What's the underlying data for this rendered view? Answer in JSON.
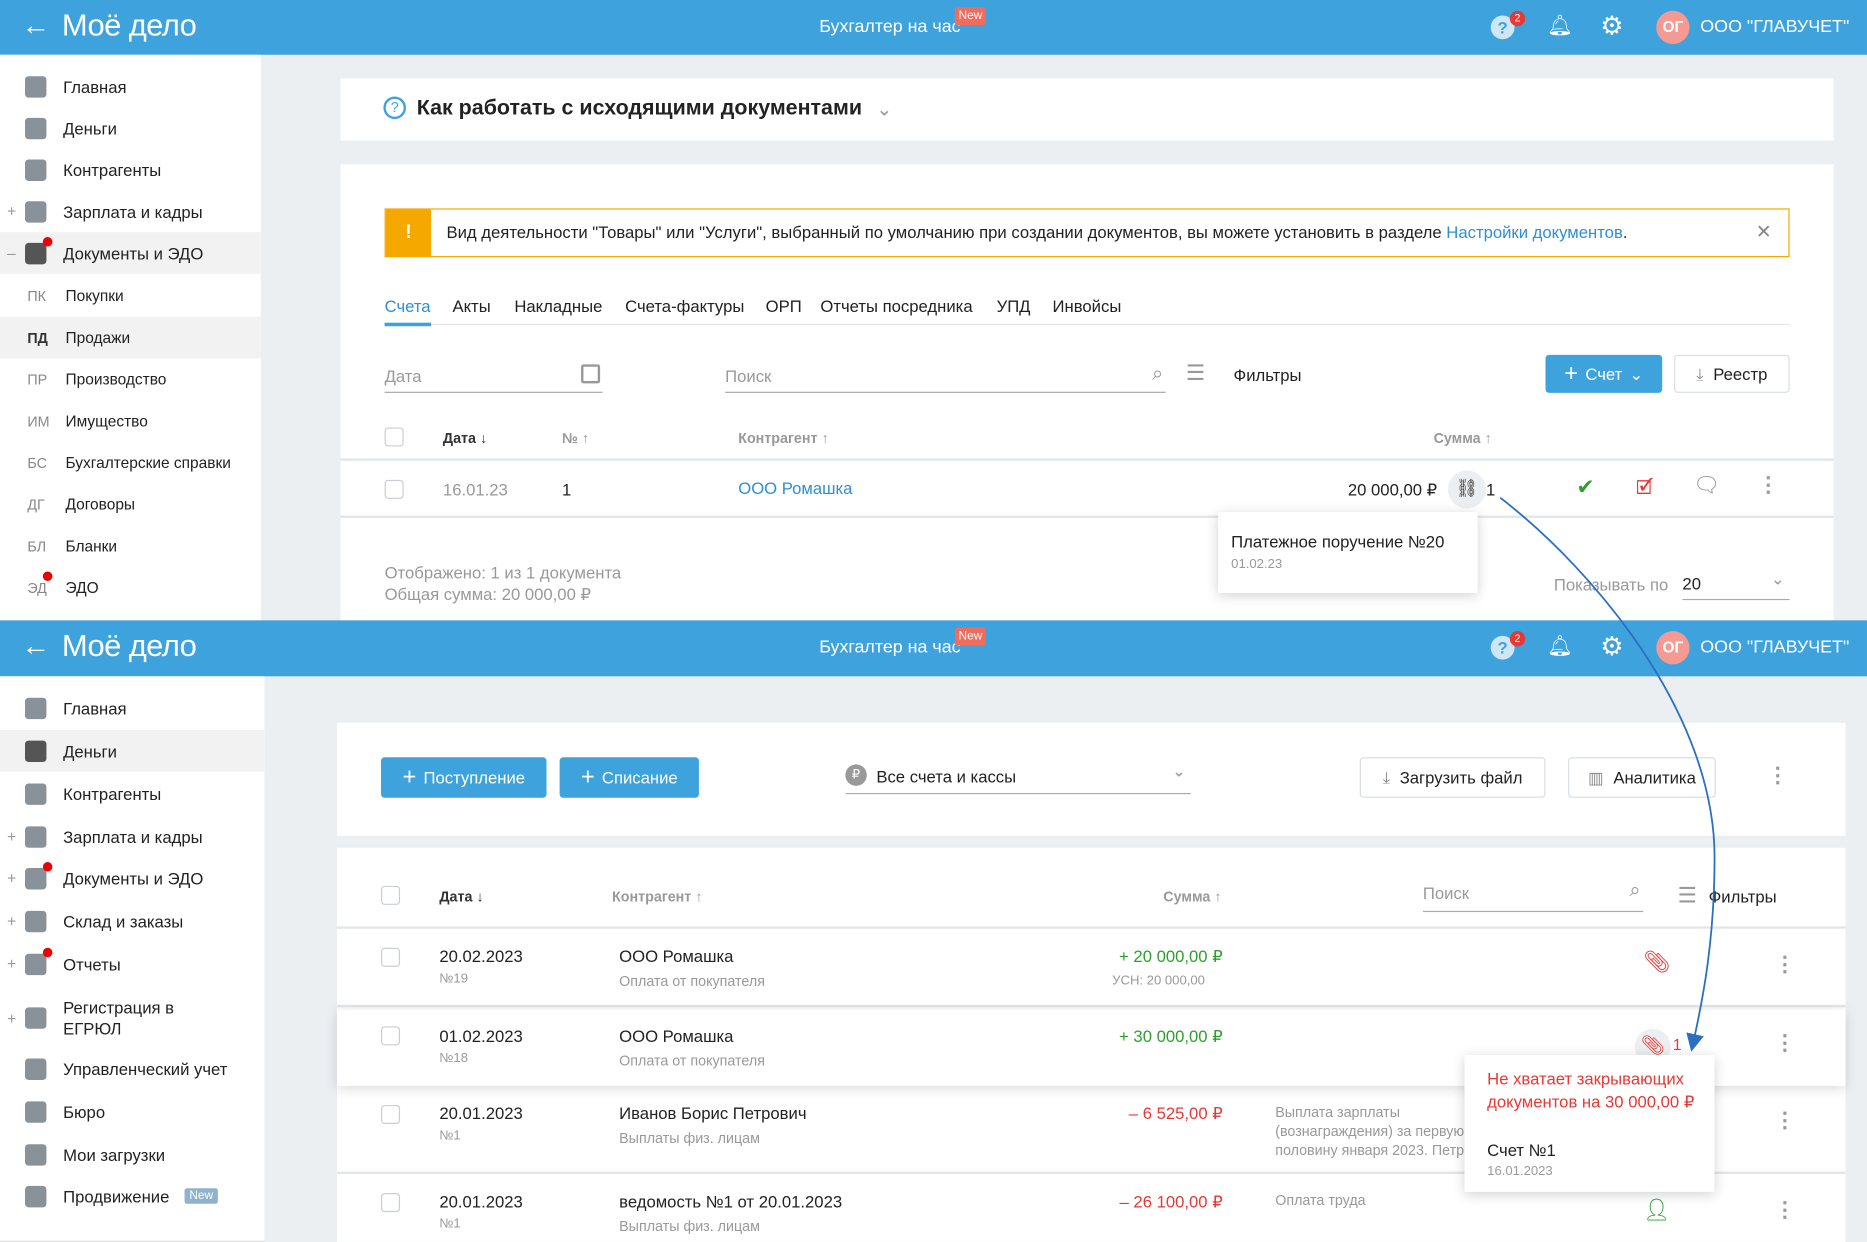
{
  "header": {
    "logo": "Моё дело",
    "center_link": "Бухгалтер на час",
    "new_badge": "New",
    "help_badge": "2",
    "avatar_initials": "ОГ",
    "org_name": "ООО \"ГЛАВУЧЕТ\""
  },
  "top": {
    "sidebar": [
      {
        "label": "Главная"
      },
      {
        "label": "Деньги"
      },
      {
        "label": "Контрагенты"
      },
      {
        "label": "Зарплата и кадры"
      },
      {
        "label": "Документы и ЭДО"
      }
    ],
    "subitems": [
      {
        "abbr": "ПК",
        "label": "Покупки"
      },
      {
        "abbr": "ПД",
        "label": "Продажи"
      },
      {
        "abbr": "ПР",
        "label": "Производство"
      },
      {
        "abbr": "ИМ",
        "label": "Имущество"
      },
      {
        "abbr": "БС",
        "label": "Бухгалтерские справки"
      },
      {
        "abbr": "ДГ",
        "label": "Договоры"
      },
      {
        "abbr": "БЛ",
        "label": "Бланки"
      },
      {
        "abbr": "ЭД",
        "label": "ЭДО"
      }
    ],
    "help_title": "Как работать с исходящими документами",
    "warning": {
      "text": "Вид деятельности \"Товары\" или \"Услуги\", выбранный по умолчанию при создании документов, вы можете установить в разделе ",
      "link": "Настройки документов",
      "tail": "."
    },
    "tabs": [
      "Счета",
      "Акты",
      "Накладные",
      "Счета-фактуры",
      "ОРП",
      "Отчеты посредника",
      "УПД",
      "Инвойсы"
    ],
    "date_placeholder": "Дата",
    "search_placeholder": "Поиск",
    "filters": "Фильтры",
    "new_invoice": "Счет",
    "registry": "Реестр",
    "columns": {
      "date": "Дата ↓",
      "num": "№ ↑",
      "contractor": "Контрагент ↑",
      "sum": "Сумма ↑"
    },
    "row": {
      "date": "16.01.23",
      "num": "1",
      "contractor": "ООО Ромашка",
      "sum": "20 000,00 ₽",
      "links": "1"
    },
    "tooltip": {
      "title": "Платежное поручение №20",
      "date": "01.02.23"
    },
    "shown": "Отображено: 1 из 1 документа",
    "total": "Общая сумма: 20 000,00 ₽",
    "per_page_label": "Показывать по",
    "per_page": "20"
  },
  "bottom": {
    "sidebar": [
      {
        "label": "Главная"
      },
      {
        "label": "Деньги"
      },
      {
        "label": "Контрагенты"
      },
      {
        "label": "Зарплата и кадры"
      },
      {
        "label": "Документы и ЭДО"
      },
      {
        "label": "Склад и заказы"
      },
      {
        "label": "Отчеты"
      },
      {
        "label": "Регистрация в ЕГРЮЛ"
      },
      {
        "label": "Управленческий учет"
      },
      {
        "label": "Бюро"
      },
      {
        "label": "Мои загрузки"
      },
      {
        "label": "Продвижение",
        "badge": "New"
      }
    ],
    "income": "Поступление",
    "expense": "Списание",
    "accounts": "Все счета и кассы",
    "upload": "Загрузить файл",
    "analytics": "Аналитика",
    "columns": {
      "date": "Дата ↓",
      "contractor": "Контрагент ↑",
      "sum": "Сумма ↑"
    },
    "search_placeholder": "Поиск",
    "filters": "Фильтры",
    "rows": [
      {
        "date": "20.02.2023",
        "num": "№19",
        "contractor": "ООО Ромашка",
        "type": "Оплата от покупателя",
        "sum": "+ 20 000,00 ₽",
        "note": "УСН: 20 000,00",
        "desc": ""
      },
      {
        "date": "01.02.2023",
        "num": "№18",
        "contractor": "ООО Ромашка",
        "type": "Оплата от покупателя",
        "sum": "+ 30 000,00 ₽",
        "note": "",
        "desc": "",
        "links": "1"
      },
      {
        "date": "20.01.2023",
        "num": "№1",
        "contractor": "Иванов Борис Петрович",
        "type": "Выплаты физ. лицам",
        "sum": "– 6 525,00 ₽",
        "desc": "Выплата зарплаты (вознаграждения) за первую половину января 2023. Петрович. НДС не облагается"
      },
      {
        "date": "20.01.2023",
        "num": "№1",
        "contractor": "ведомость №1 от 20.01.2023",
        "type": "Выплаты физ. лицам",
        "sum": "– 26 100,00 ₽",
        "desc": "Оплата труда"
      }
    ],
    "tooltip": {
      "warning": "Не хватает закрывающих документов на 30 000,00 ₽",
      "doc": "Счет №1",
      "date": "16.01.2023"
    }
  }
}
